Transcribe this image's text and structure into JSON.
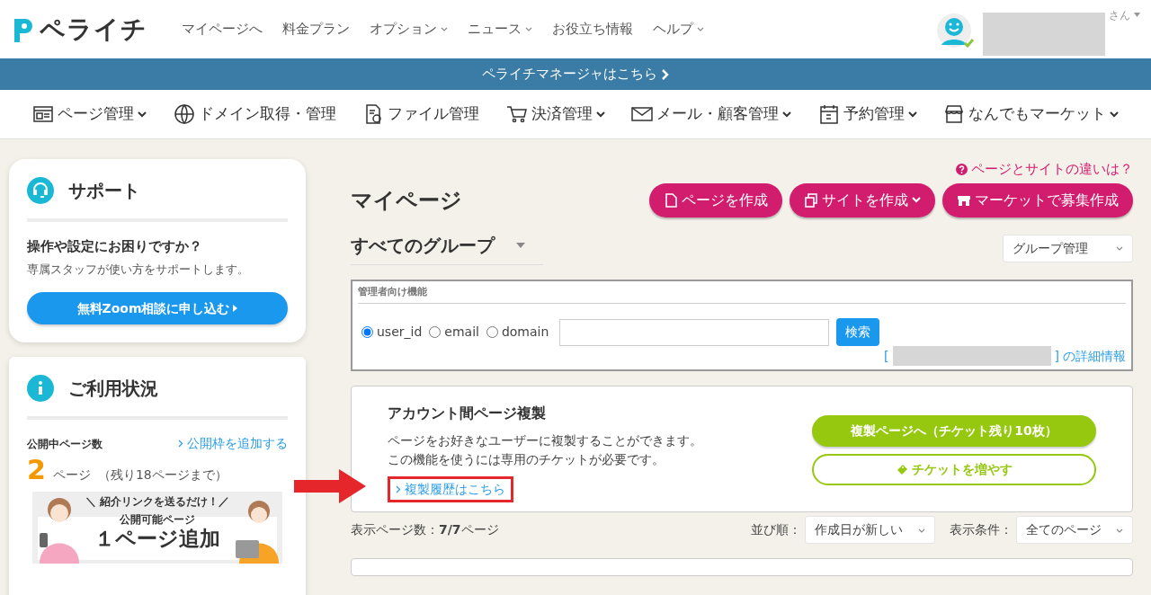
{
  "header": {
    "logo": "ペライチ",
    "nav": [
      {
        "label": "マイページへ",
        "dropdown": false
      },
      {
        "label": "料金プラン",
        "dropdown": false
      },
      {
        "label": "オプション",
        "dropdown": true
      },
      {
        "label": "ニュース",
        "dropdown": true
      },
      {
        "label": "お役立ち情報",
        "dropdown": false
      },
      {
        "label": "ヘルプ",
        "dropdown": true
      }
    ],
    "user_suffix": "さん"
  },
  "manager_bar": {
    "label": "ペライチマネージャはこちら"
  },
  "menu": [
    {
      "kind": "page",
      "label": "ページ管理",
      "dropdown": true
    },
    {
      "kind": "domain",
      "label": "ドメイン取得・管理",
      "dropdown": false
    },
    {
      "kind": "file",
      "label": "ファイル管理",
      "dropdown": false
    },
    {
      "kind": "cart",
      "label": "決済管理",
      "dropdown": true
    },
    {
      "kind": "mail",
      "label": "メール・顧客管理",
      "dropdown": true
    },
    {
      "kind": "calendar",
      "label": "予約管理",
      "dropdown": true
    },
    {
      "kind": "shop",
      "label": "なんでもマーケット",
      "dropdown": true
    }
  ],
  "support": {
    "title": "サポート",
    "question": "操作や設定にお困りですか？",
    "description": "専属スタッフが使い方をサポートします。",
    "button": "無料Zoom相談に申し込む"
  },
  "usage": {
    "title": "ご利用状況",
    "label": "公開中ページ数",
    "add_link": "公開枠を追加する",
    "count": "2",
    "unit": "ページ",
    "remaining": "（残り18ページまで）",
    "banner": {
      "kind": "picture",
      "top": "＼ 紹介リンクを送るだけ！／",
      "subtitle": "公開可能ページ",
      "headline": "１ページ追加"
    }
  },
  "main": {
    "help_link": "ページとサイトの違いは？",
    "title": "マイページ",
    "actions": [
      {
        "kind": "page",
        "label": "ページを作成",
        "dropdown": false
      },
      {
        "kind": "site",
        "label": "サイトを作成",
        "dropdown": true
      },
      {
        "kind": "shop",
        "label": "マーケットで募集作成",
        "dropdown": false
      }
    ],
    "group": {
      "label": "すべてのグループ"
    },
    "group_manage": {
      "value": "グループ管理"
    },
    "admin": {
      "legend": "管理者向け機能",
      "radios": [
        {
          "label": "user_id",
          "selected": true
        },
        {
          "label": "email",
          "selected": false
        },
        {
          "label": "domain",
          "selected": false
        }
      ],
      "search_button": "検索",
      "open_bracket": "[",
      "close_bracket": "]",
      "detail_link": "の詳細情報"
    },
    "copy": {
      "title": "アカウント間ページ複製",
      "lines": [
        "ページをお好きなユーザーに複製することができます。",
        "この機能を使うには専用のチケットが必要です。"
      ],
      "history_link": {
        "label": "複製履歴はこちら",
        "highlighted": true
      },
      "primary_button": "複製ページへ（チケット残り10枚）",
      "secondary_button": "チケットを増やす"
    },
    "listing": {
      "count": "表示ページ数：**7/7**ページ",
      "sort_label": "並び順：",
      "sort_value": "作成日が新しい",
      "filter_label": "表示条件：",
      "filter_value": "全てのページ"
    }
  }
}
